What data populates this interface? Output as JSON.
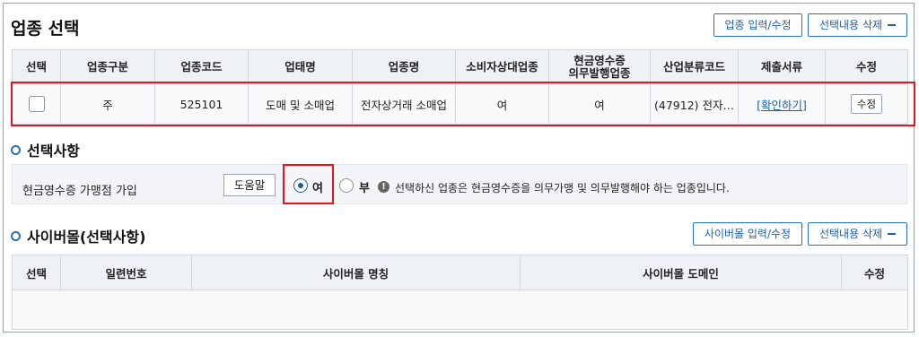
{
  "section1": {
    "title": "업종 선택",
    "btn_input": "업종 입력/수정",
    "btn_delete": "선택내용 삭제",
    "columns": [
      "선택",
      "업종구분",
      "업종코드",
      "업태명",
      "업종명",
      "소비자상대업종",
      "현금영수증\n의무발행업종",
      "산업분류코드",
      "제출서류",
      "수정"
    ],
    "row": {
      "type": "주",
      "code": "525101",
      "business": "도매 및 소매업",
      "industry": "전자상거래 소매업",
      "consumer": "여",
      "cash_receipt": "여",
      "class_code": "(47912) 전자…",
      "docs_link": "[확인하기]",
      "edit": "수정"
    }
  },
  "section2": {
    "title": "선택사항",
    "label": "현금영수증 가맹점 가입",
    "help": "도움말",
    "radio_yes": "여",
    "radio_no": "부",
    "info_icon_glyph": "!",
    "info": "선택하신 업종은 현금영수증을 의무가맹 및 의무발행해야 하는 업종입니다."
  },
  "section3": {
    "title": "사이버몰(선택사항)",
    "btn_input": "사이버몰 입력/수정",
    "btn_delete": "선택내용 삭제",
    "columns": [
      "선택",
      "일련번호",
      "사이버몰 명칭",
      "사이버몰 도메인",
      "수정"
    ]
  },
  "colors": {
    "accent": "#1d5fa8",
    "highlight": "#e3141c",
    "header_bg": "#eef1f6"
  }
}
